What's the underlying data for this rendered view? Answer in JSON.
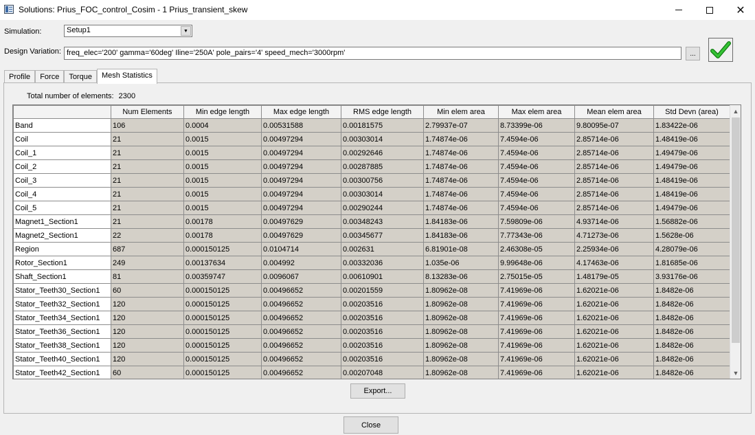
{
  "window": {
    "title": "Solutions: Prius_FOC_control_Cosim - 1 Prius_transient_skew",
    "minimize_icon": "minimize-icon",
    "maximize_icon": "maximize-icon",
    "close_glyph": "✕"
  },
  "simulation": {
    "label": "Simulation:",
    "value": "Setup1"
  },
  "design_variation": {
    "label": "Design Variation:",
    "value": "freq_elec='200' gamma='60deg' Iline='250A' pole_pairs='4' speed_mech='3000rpm'",
    "browse_label": "...",
    "apply_icon": "green-check-icon",
    "check_color": "#1aa01a"
  },
  "tabs": [
    {
      "label": "Profile",
      "active": false
    },
    {
      "label": "Force",
      "active": false
    },
    {
      "label": "Torque",
      "active": false
    },
    {
      "label": "Mesh Statistics",
      "active": true
    }
  ],
  "total": {
    "label": "Total number of elements:",
    "value": "2300"
  },
  "table": {
    "columns": [
      "",
      "Num Elements",
      "Min edge length",
      "Max edge length",
      "RMS edge length",
      "Min elem area",
      "Max elem area",
      "Mean elem area",
      "Std Devn (area)"
    ],
    "rows": [
      [
        "Band",
        "106",
        "0.0004",
        "0.00531588",
        "0.00181575",
        "2.79937e-07",
        "8.73399e-06",
        "9.80095e-07",
        "1.83422e-06"
      ],
      [
        "Coil",
        "21",
        "0.0015",
        "0.00497294",
        "0.00303014",
        "1.74874e-06",
        "7.4594e-06",
        "2.85714e-06",
        "1.48419e-06"
      ],
      [
        "Coil_1",
        "21",
        "0.0015",
        "0.00497294",
        "0.00292646",
        "1.74874e-06",
        "7.4594e-06",
        "2.85714e-06",
        "1.49479e-06"
      ],
      [
        "Coil_2",
        "21",
        "0.0015",
        "0.00497294",
        "0.00287885",
        "1.74874e-06",
        "7.4594e-06",
        "2.85714e-06",
        "1.49479e-06"
      ],
      [
        "Coil_3",
        "21",
        "0.0015",
        "0.00497294",
        "0.00300756",
        "1.74874e-06",
        "7.4594e-06",
        "2.85714e-06",
        "1.48419e-06"
      ],
      [
        "Coil_4",
        "21",
        "0.0015",
        "0.00497294",
        "0.00303014",
        "1.74874e-06",
        "7.4594e-06",
        "2.85714e-06",
        "1.48419e-06"
      ],
      [
        "Coil_5",
        "21",
        "0.0015",
        "0.00497294",
        "0.00290244",
        "1.74874e-06",
        "7.4594e-06",
        "2.85714e-06",
        "1.49479e-06"
      ],
      [
        "Magnet1_Section1",
        "21",
        "0.00178",
        "0.00497629",
        "0.00348243",
        "1.84183e-06",
        "7.59809e-06",
        "4.93714e-06",
        "1.56882e-06"
      ],
      [
        "Magnet2_Section1",
        "22",
        "0.00178",
        "0.00497629",
        "0.00345677",
        "1.84183e-06",
        "7.77343e-06",
        "4.71273e-06",
        "1.5628e-06"
      ],
      [
        "Region",
        "687",
        "0.000150125",
        "0.0104714",
        "0.002631",
        "6.81901e-08",
        "2.46308e-05",
        "2.25934e-06",
        "4.28079e-06"
      ],
      [
        "Rotor_Section1",
        "249",
        "0.00137634",
        "0.004992",
        "0.00332036",
        "1.035e-06",
        "9.99648e-06",
        "4.17463e-06",
        "1.81685e-06"
      ],
      [
        "Shaft_Section1",
        "81",
        "0.00359747",
        "0.0096067",
        "0.00610901",
        "8.13283e-06",
        "2.75015e-05",
        "1.48179e-05",
        "3.93176e-06"
      ],
      [
        "Stator_Teeth30_Section1",
        "60",
        "0.000150125",
        "0.00496652",
        "0.00201559",
        "1.80962e-08",
        "7.41969e-06",
        "1.62021e-06",
        "1.8482e-06"
      ],
      [
        "Stator_Teeth32_Section1",
        "120",
        "0.000150125",
        "0.00496652",
        "0.00203516",
        "1.80962e-08",
        "7.41969e-06",
        "1.62021e-06",
        "1.8482e-06"
      ],
      [
        "Stator_Teeth34_Section1",
        "120",
        "0.000150125",
        "0.00496652",
        "0.00203516",
        "1.80962e-08",
        "7.41969e-06",
        "1.62021e-06",
        "1.8482e-06"
      ],
      [
        "Stator_Teeth36_Section1",
        "120",
        "0.000150125",
        "0.00496652",
        "0.00203516",
        "1.80962e-08",
        "7.41969e-06",
        "1.62021e-06",
        "1.8482e-06"
      ],
      [
        "Stator_Teeth38_Section1",
        "120",
        "0.000150125",
        "0.00496652",
        "0.00203516",
        "1.80962e-08",
        "7.41969e-06",
        "1.62021e-06",
        "1.8482e-06"
      ],
      [
        "Stator_Teeth40_Section1",
        "120",
        "0.000150125",
        "0.00496652",
        "0.00203516",
        "1.80962e-08",
        "7.41969e-06",
        "1.62021e-06",
        "1.8482e-06"
      ],
      [
        "Stator_Teeth42_Section1",
        "60",
        "0.000150125",
        "0.00496652",
        "0.00207048",
        "1.80962e-08",
        "7.41969e-06",
        "1.62021e-06",
        "1.8482e-06"
      ]
    ]
  },
  "buttons": {
    "export_label": "Export...",
    "close_label": "Close"
  },
  "scrollbar": {
    "up_icon": "scroll-up-arrow-icon",
    "down_icon": "scroll-down-arrow-icon"
  }
}
